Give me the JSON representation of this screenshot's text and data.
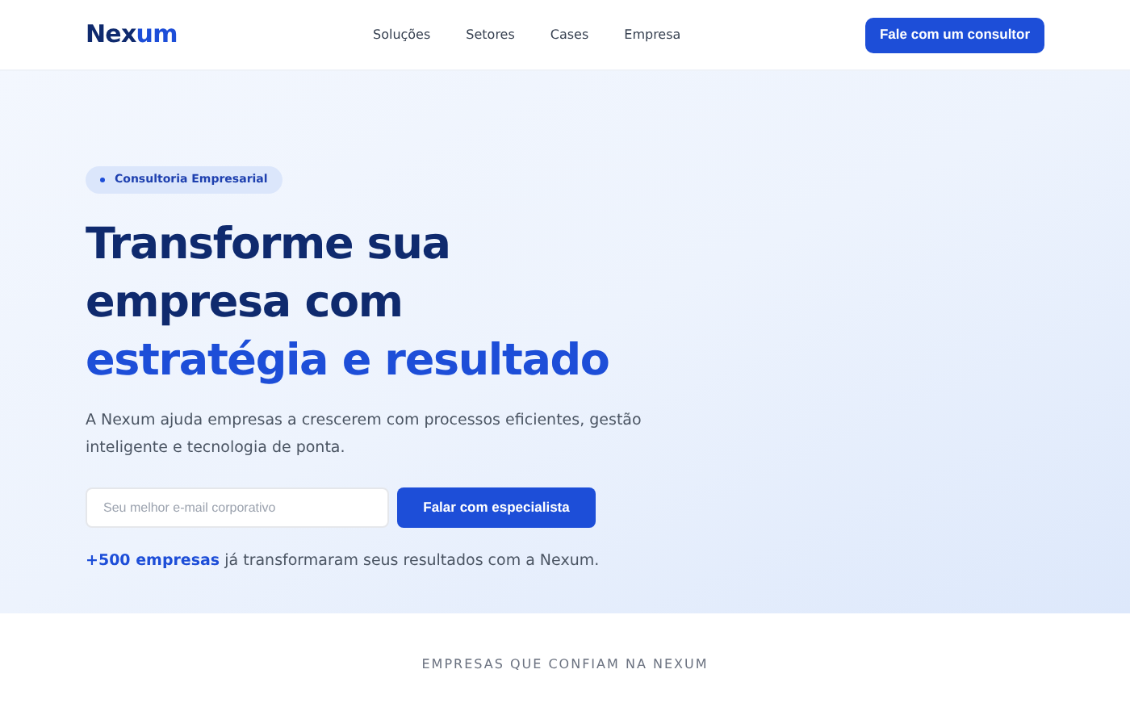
{
  "logo": {
    "main": "Nex",
    "accent": "um"
  },
  "nav": {
    "links": [
      "Soluções",
      "Setores",
      "Cases",
      "Empresa"
    ],
    "cta": "Fale com um consultor"
  },
  "hero": {
    "badge": "Consultoria Empresarial",
    "headline": [
      {
        "text": "Transforme sua",
        "accent": false
      },
      {
        "text": "empresa com",
        "accent": false
      },
      {
        "text": "estratégia e resultado",
        "accent": true
      }
    ],
    "description": "A Nexum ajuda empresas a crescerem com processos eficientes, gestão inteligente e tecnologia de ponta.",
    "email": {
      "placeholder": "Seu melhor e-mail corporativo"
    },
    "submit": "Falar com especialista",
    "proof": {
      "highlight": "+500 empresas",
      "rest": " já transformaram seus resultados com a Nexum."
    }
  },
  "clients": {
    "title": "EMPRESAS QUE CONFIAM NA NEXUM"
  }
}
